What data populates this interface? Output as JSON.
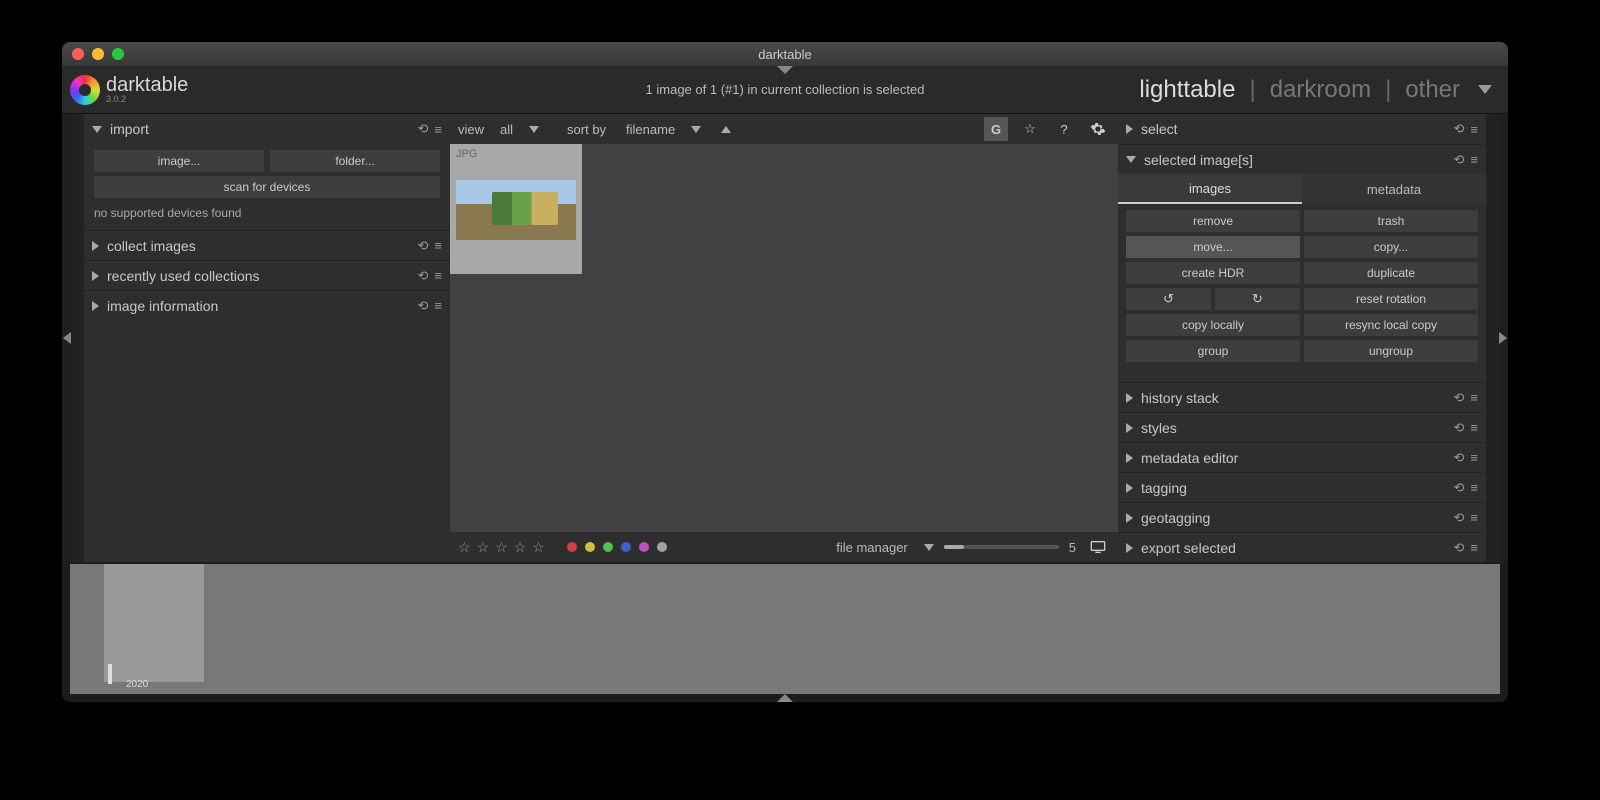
{
  "window_title": "darktable",
  "brand": {
    "name": "darktable",
    "version": "3.0.2"
  },
  "collection_info": "1 image of 1 (#1) in current collection is selected",
  "tabs": {
    "lighttable": "lighttable",
    "darkroom": "darkroom",
    "other": "other"
  },
  "left": {
    "import": {
      "title": "import",
      "image_btn": "image...",
      "folder_btn": "folder...",
      "scan_btn": "scan for devices",
      "no_devices": "no supported devices found"
    },
    "collect": "collect images",
    "recent": "recently used collections",
    "info": "image information"
  },
  "center_top": {
    "view_label": "view",
    "view_value": "all",
    "sort_label": "sort by",
    "sort_value": "filename"
  },
  "thumb": {
    "ext": "JPG"
  },
  "center_bot": {
    "mode": "file manager",
    "zoom": "5",
    "dot_colors": [
      "#d04040",
      "#d0c040",
      "#50c050",
      "#4060d0",
      "#c050c0",
      "#a0a0a0"
    ]
  },
  "right": {
    "select": "select",
    "selected": "selected image[s]",
    "tabs": {
      "images": "images",
      "metadata": "metadata"
    },
    "btns": {
      "remove": "remove",
      "trash": "trash",
      "move": "move...",
      "copy": "copy...",
      "hdr": "create HDR",
      "dup": "duplicate",
      "reset": "reset rotation",
      "copyloc": "copy locally",
      "resync": "resync local copy",
      "group": "group",
      "ungroup": "ungroup"
    },
    "history": "history stack",
    "styles": "styles",
    "meta": "metadata editor",
    "tagging": "tagging",
    "geo": "geotagging",
    "export": "export selected"
  },
  "timeline": {
    "year": "2020"
  }
}
